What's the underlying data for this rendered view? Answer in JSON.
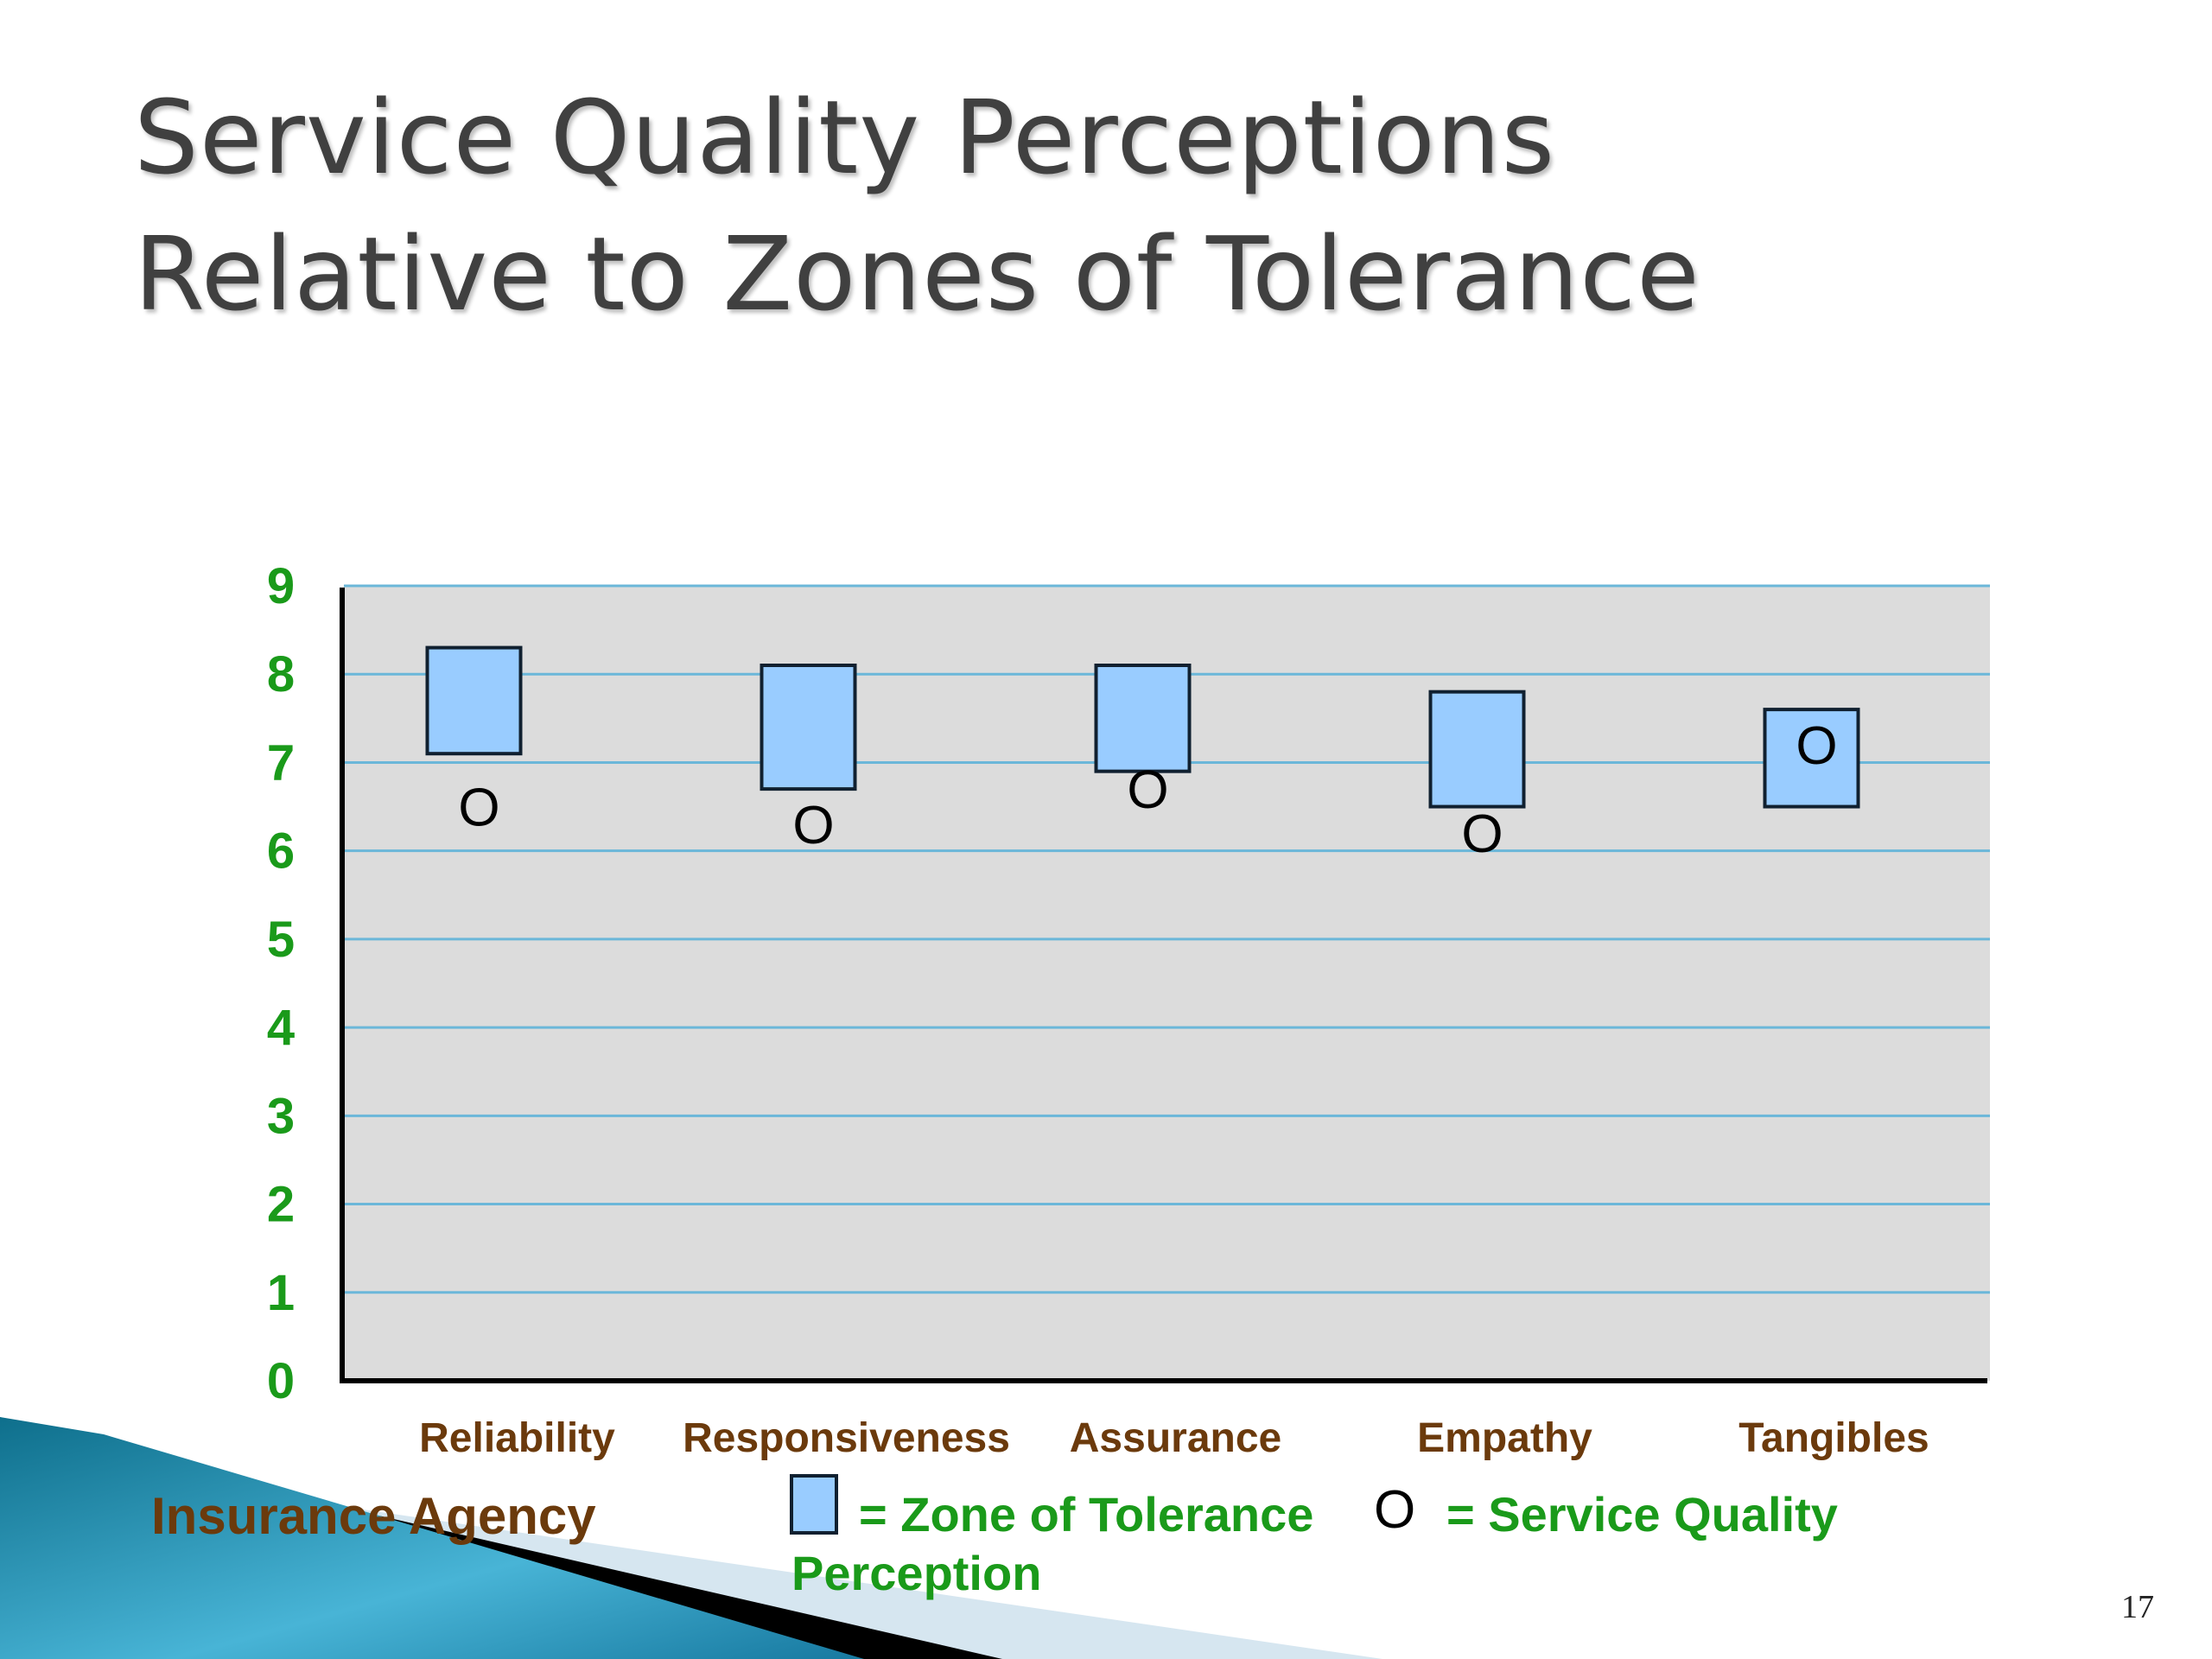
{
  "slide": {
    "title_line1": "Service Quality Perceptions",
    "title_line2": "Relative to Zones of Tolerance",
    "page_number": "17",
    "subject_label": "Insurance Agency"
  },
  "legend": {
    "zone_marker": "box",
    "zone_label": "= Zone of Tolerance",
    "perception_marker": "O",
    "perception_label_line1": "= Service Quality",
    "perception_label_line2": "Perception"
  },
  "colors": {
    "zone_fill": "#99ccff",
    "plot_bg": "#dcdcdc",
    "gridline": "#6bb7d9",
    "ytick": "#1a9a1a",
    "xtick": "#6b3a0c",
    "decor_teal": "#1f88a8"
  },
  "chart_data": {
    "type": "range-with-point",
    "title": "Service Quality Perceptions Relative to Zones of Tolerance",
    "xlabel": "",
    "ylabel": "",
    "categories": [
      "Reliability",
      "Responsiveness",
      "Assurance",
      "Empathy",
      "Tangibles"
    ],
    "yticks": [
      "0",
      "1",
      "2",
      "3",
      "4",
      "5",
      "6",
      "7",
      "8",
      "9"
    ],
    "ylim": [
      0,
      9
    ],
    "grid": true,
    "legend_position": "bottom",
    "series": [
      {
        "name": "Zone of Tolerance (low)",
        "values": [
          7.1,
          6.7,
          6.9,
          6.5,
          6.5
        ]
      },
      {
        "name": "Zone of Tolerance (high)",
        "values": [
          8.3,
          8.1,
          8.1,
          7.8,
          7.6
        ]
      },
      {
        "name": "Service Quality Perception",
        "values": [
          6.5,
          6.3,
          6.7,
          6.2,
          7.2
        ]
      }
    ]
  }
}
